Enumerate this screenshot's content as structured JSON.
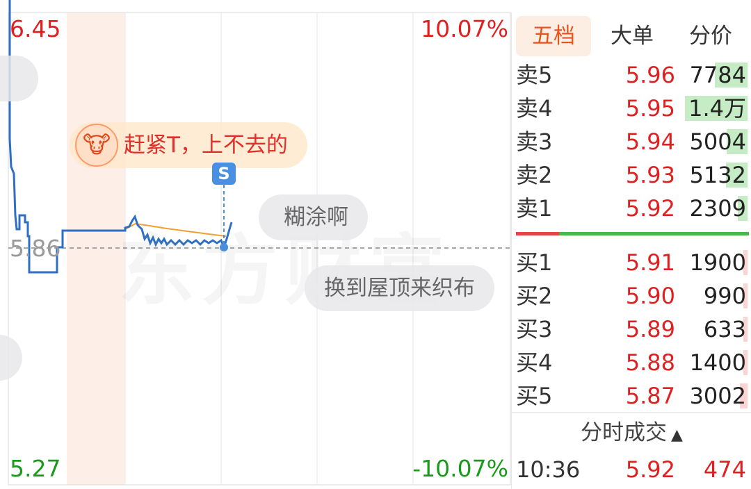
{
  "chart": {
    "price_high": "6.45",
    "price_low": "5.27",
    "pct_high": "10.07%",
    "pct_low": "-10.07%",
    "prev_close": "5.86",
    "watermark": "东方财富",
    "colors": {
      "up": "#e02020",
      "down": "#1a9a1a",
      "price_line": "#2e6fc4",
      "avg_line": "#f0a030"
    }
  },
  "comments": [
    {
      "text": "赶紧T，上不去的",
      "style": "orange",
      "avatar": "cow-avatar-icon"
    },
    {
      "text": "糊涂啊",
      "style": "grey"
    },
    {
      "text": "换到屋顶来织布",
      "style": "grey"
    }
  ],
  "marker": {
    "label": "S"
  },
  "orderbook": {
    "tabs": [
      {
        "label": "五档",
        "active": true
      },
      {
        "label": "大单",
        "active": false
      },
      {
        "label": "分价",
        "active": false
      }
    ],
    "sell": [
      {
        "label": "卖5",
        "price": "5.96",
        "volume": "7784",
        "bar": 0.52
      },
      {
        "label": "卖4",
        "price": "5.95",
        "volume": "1.4万",
        "bar": 1.0
      },
      {
        "label": "卖3",
        "price": "5.94",
        "volume": "5004",
        "bar": 0.33
      },
      {
        "label": "卖2",
        "price": "5.93",
        "volume": "5132",
        "bar": 0.35
      },
      {
        "label": "卖1",
        "price": "5.92",
        "volume": "2309",
        "bar": 0.16
      }
    ],
    "buy": [
      {
        "label": "买1",
        "price": "5.91",
        "volume": "1900",
        "bar": 0.07
      },
      {
        "label": "买2",
        "price": "5.90",
        "volume": "990",
        "bar": 0.05
      },
      {
        "label": "买3",
        "price": "5.89",
        "volume": "633",
        "bar": 0.04
      },
      {
        "label": "买4",
        "price": "5.88",
        "volume": "1400",
        "bar": 0.06
      },
      {
        "label": "买5",
        "price": "5.87",
        "volume": "3002",
        "bar": 0.12
      }
    ]
  },
  "trades": {
    "header": "分时成交",
    "rows": [
      {
        "time": "10:36",
        "price": "5.92",
        "volume": "474"
      }
    ]
  }
}
